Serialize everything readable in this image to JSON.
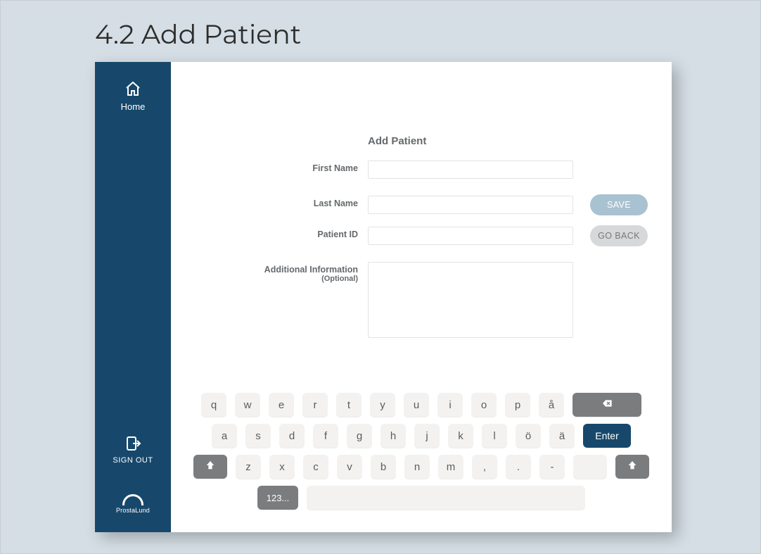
{
  "page_heading": "4.2 Add Patient",
  "sidebar": {
    "home_label": "Home",
    "signout_label": "SIGN OUT",
    "logo_text": "ProstaLund"
  },
  "form": {
    "title": "Add Patient",
    "first_name_label": "First Name",
    "first_name_value": "",
    "last_name_label": "Last Name",
    "last_name_value": "",
    "patient_id_label": "Patient ID",
    "patient_id_value": "",
    "additional_label": "Additional Information",
    "additional_optional": "(Optional)",
    "additional_value": ""
  },
  "buttons": {
    "save": "SAVE",
    "go_back": "GO BACK"
  },
  "keyboard": {
    "row1": [
      "q",
      "w",
      "e",
      "r",
      "t",
      "y",
      "u",
      "i",
      "o",
      "p",
      "å"
    ],
    "row2": [
      "a",
      "s",
      "d",
      "f",
      "g",
      "h",
      "j",
      "k",
      "l",
      "ö",
      "ä"
    ],
    "row3": [
      "z",
      "x",
      "c",
      "v",
      "b",
      "n",
      "m",
      ",",
      ".",
      "-"
    ],
    "enter": "Enter",
    "numkey": "123..."
  }
}
